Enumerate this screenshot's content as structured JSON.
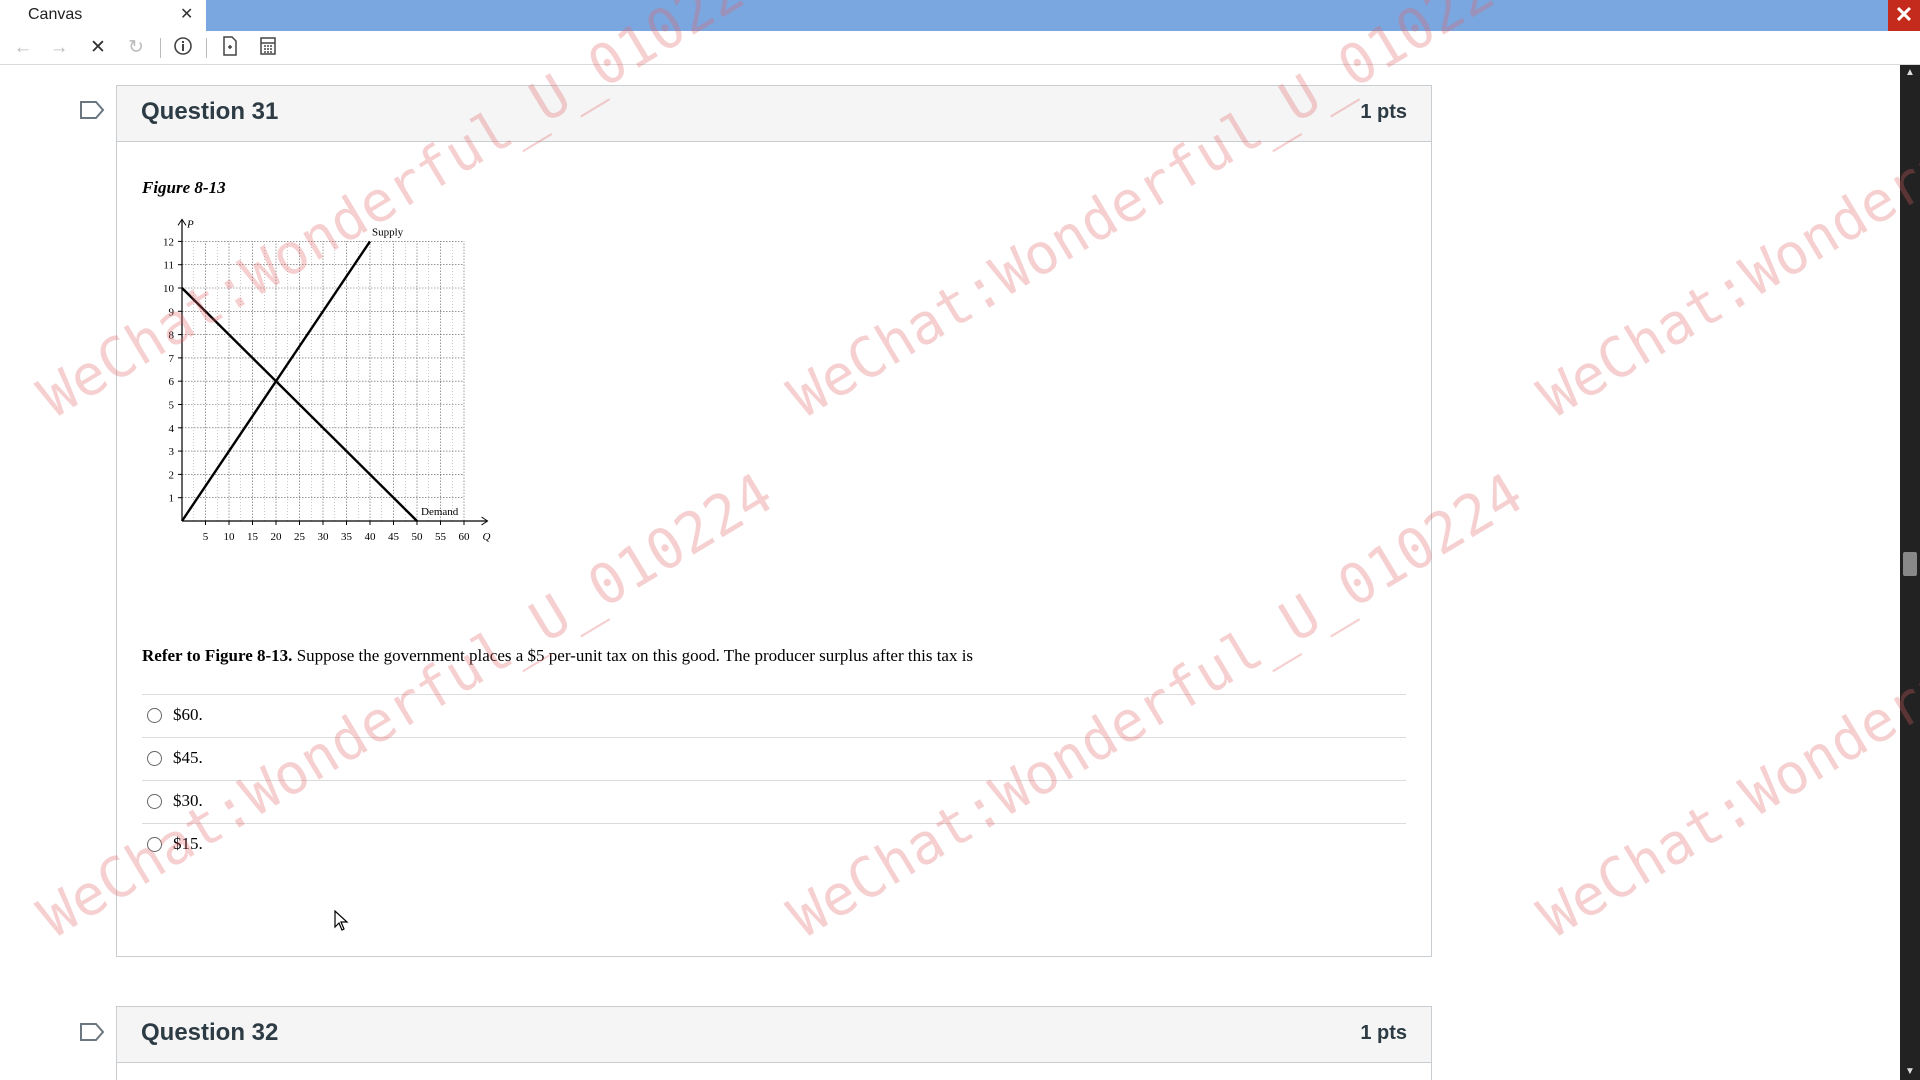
{
  "window": {
    "tab_title": "Canvas",
    "tab_close_icon": "close-icon",
    "close_icon": "close-icon"
  },
  "toolbar": {
    "icons": [
      "back-icon",
      "forward-icon",
      "stop-icon",
      "reload-icon",
      "info-icon",
      "document-icon",
      "calculator-icon"
    ]
  },
  "questions": [
    {
      "title": "Question 31",
      "points": "1 pts",
      "figure_label": "Figure 8-13",
      "text_bold": "Refer to Figure 8-13.",
      "text": "Suppose the government places a $5 per-unit tax on this good. The producer surplus after this tax is",
      "answers": [
        "$60.",
        "$45.",
        "$30.",
        "$15."
      ]
    },
    {
      "title": "Question 32",
      "points": "1 pts"
    }
  ],
  "chart_data": {
    "type": "line",
    "xlabel": "Q",
    "ylabel": "P",
    "xlim": [
      0,
      65
    ],
    "ylim": [
      0,
      12
    ],
    "x_ticks": [
      5,
      10,
      15,
      20,
      25,
      30,
      35,
      40,
      45,
      50,
      55,
      60
    ],
    "y_ticks": [
      1,
      2,
      3,
      4,
      5,
      6,
      7,
      8,
      9,
      10,
      11,
      12
    ],
    "grid": true,
    "series": [
      {
        "name": "Supply",
        "x": [
          0,
          40
        ],
        "y": [
          0,
          12
        ]
      },
      {
        "name": "Demand",
        "x": [
          0,
          50
        ],
        "y": [
          10,
          0
        ]
      }
    ]
  },
  "watermark": {
    "line1": "WeChat:Wonderful_U_010224",
    "line2": "WeChat:Wonderful_U_010224",
    "line3": "WeChat:Wonderful_U_010224",
    "line4": "WeChat:Wonderful_U_010224",
    "line5": "WeChat:Wonderful_U_010224",
    "line6": "WeChat:Wonderful_U_010224"
  }
}
